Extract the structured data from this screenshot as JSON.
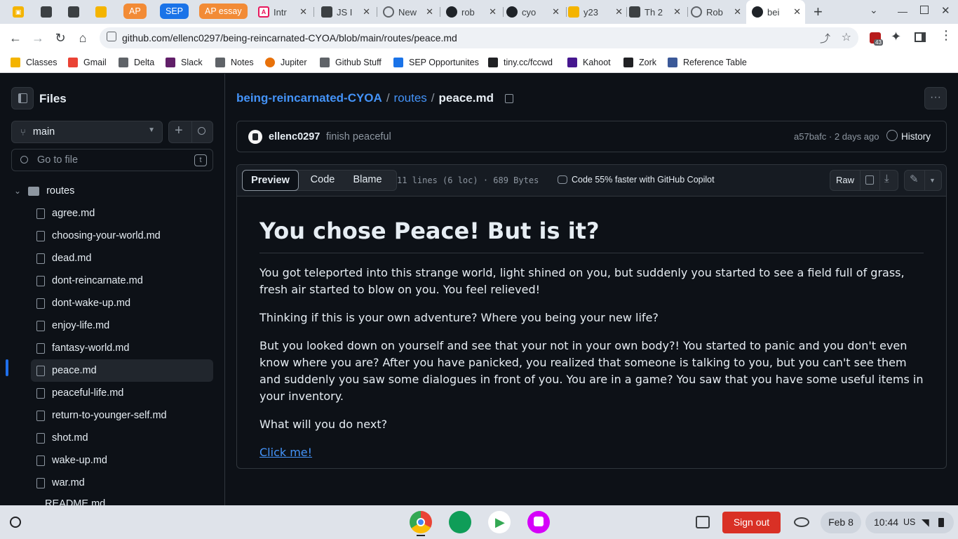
{
  "tabs": [
    {
      "label": "",
      "favicon_color": "#f4b400"
    },
    {
      "label": "",
      "favicon_color": "#3c4043"
    },
    {
      "label": "",
      "favicon_color": "#3c4043"
    },
    {
      "label": "",
      "favicon_color": "#f4b400"
    },
    {
      "label": "AP",
      "group_color": "#f28b36"
    },
    {
      "label": "SEP",
      "group_color": "#1a73e8"
    },
    {
      "label": "AP essay",
      "group_color": "#f28b36"
    },
    {
      "label": "Intr",
      "favicon_color": "#e8175d"
    },
    {
      "label": "JS I",
      "favicon_color": "#3c4043"
    },
    {
      "label": "New",
      "favicon_color": "#5f6368"
    },
    {
      "label": "rob",
      "favicon_color": "#1f2328"
    },
    {
      "label": "cyo",
      "favicon_color": "#1f2328"
    },
    {
      "label": "y23",
      "favicon_color": "#f4b400"
    },
    {
      "label": "Th 2",
      "favicon_color": "#3c4043"
    },
    {
      "label": "Rob",
      "favicon_color": "#5f6368"
    },
    {
      "label": "bei",
      "favicon_color": "#1f2328",
      "active": true
    }
  ],
  "toolbar": {
    "url": "github.com/ellenc0297/being-reincarnated-CYOA/blob/main/routes/peace.md",
    "extension_badge": "43"
  },
  "bookmarks": [
    {
      "label": "Classes",
      "color": "#f4b400"
    },
    {
      "label": "Gmail",
      "color": "#ea4335"
    },
    {
      "label": "Delta",
      "color": "#5f6368"
    },
    {
      "label": "Slack",
      "color": "#611f69"
    },
    {
      "label": "Notes",
      "color": "#5f6368"
    },
    {
      "label": "Jupiter",
      "color": "#e8710a"
    },
    {
      "label": "Github Stuff",
      "color": "#5f6368"
    },
    {
      "label": "SEP Opportunites",
      "color": "#1a73e8"
    },
    {
      "label": "tiny.cc/fccwd",
      "color": "#202124"
    },
    {
      "label": "Kahoot",
      "color": "#46178f"
    },
    {
      "label": "Zork",
      "color": "#202124"
    },
    {
      "label": "Reference Table",
      "color": "#3b5998"
    }
  ],
  "sidebar": {
    "title": "Files",
    "branch": "main",
    "search_placeholder": "Go to file",
    "search_shortcut": "t",
    "folder": "routes",
    "files": [
      {
        "name": "agree.md"
      },
      {
        "name": "choosing-your-world.md"
      },
      {
        "name": "dead.md"
      },
      {
        "name": "dont-reincarnate.md"
      },
      {
        "name": "dont-wake-up.md"
      },
      {
        "name": "enjoy-life.md"
      },
      {
        "name": "fantasy-world.md"
      },
      {
        "name": "peace.md",
        "selected": true
      },
      {
        "name": "peaceful-life.md"
      },
      {
        "name": "return-to-younger-self.md"
      },
      {
        "name": "shot.md"
      },
      {
        "name": "wake-up.md"
      },
      {
        "name": "war.md"
      }
    ],
    "partial_item": "README.md"
  },
  "breadcrumb": {
    "repo": "being-reincarnated-CYOA",
    "sep1": "/",
    "folder": "routes",
    "sep2": "/",
    "file": "peace.md"
  },
  "commit": {
    "author": "ellenc0297",
    "message": "finish peaceful",
    "hash": "a57bafc",
    "dot": "·",
    "time": "2 days ago",
    "history_label": "History"
  },
  "file_header": {
    "tabs": [
      "Preview",
      "Code",
      "Blame"
    ],
    "active_tab": "Preview",
    "info": "11 lines (6 loc) · 689 Bytes",
    "copilot": "Code 55% faster with GitHub Copilot",
    "raw_label": "Raw"
  },
  "markdown": {
    "heading": "You chose Peace! But is it?",
    "paragraphs": [
      "You got teleported into this strange world, light shined on you, but suddenly you started to see a field full of grass, fresh air started to blow on you. You feel relieved!",
      "Thinking if this is your own adventure? Where you being your new life?",
      "But you looked down on yourself and see that your not in your own body?! You started to panic and you don't even know where you are? After you have panicked, you realized that someone is talking to you, but you can't see them and suddenly you saw some dialogues in front of you. You are in a game? You saw that you have some useful items in your inventory.",
      "What will you do next?"
    ],
    "link": "Click me!"
  },
  "shelf": {
    "sign_out": "Sign out",
    "date": "Feb 8",
    "time": "10:44",
    "locale": "US"
  },
  "colors": {
    "gh_bg": "#0d1117",
    "gh_border": "#30363d",
    "gh_link": "#4493f8",
    "sign_out_red": "#d93025"
  }
}
